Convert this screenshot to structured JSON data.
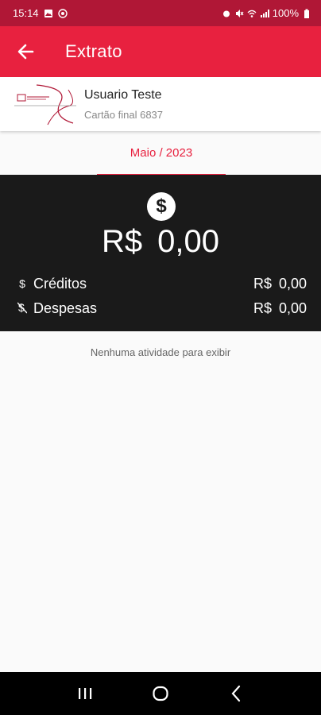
{
  "status_bar": {
    "time": "15:14",
    "battery": "100%"
  },
  "app_bar": {
    "title": "Extrato"
  },
  "user": {
    "name": "Usuario Teste",
    "card": "Cartão final 6837"
  },
  "period": {
    "label": "Maio / 2023"
  },
  "summary": {
    "total": "R$ 0,00",
    "credits_label": "Créditos",
    "credits_value": "R$ 0,00",
    "expenses_label": "Despesas",
    "expenses_value": "R$ 0,00"
  },
  "empty_message": "Nenhuma atividade para exibir",
  "colors": {
    "primary": "#e8213f",
    "status_bar": "#b01736",
    "summary_bg": "#1a1a1a"
  },
  "icons": {
    "back": "arrow-left-icon",
    "summary": "dollar-circle-icon",
    "credit": "dollar-icon",
    "debit": "dollar-off-icon"
  }
}
